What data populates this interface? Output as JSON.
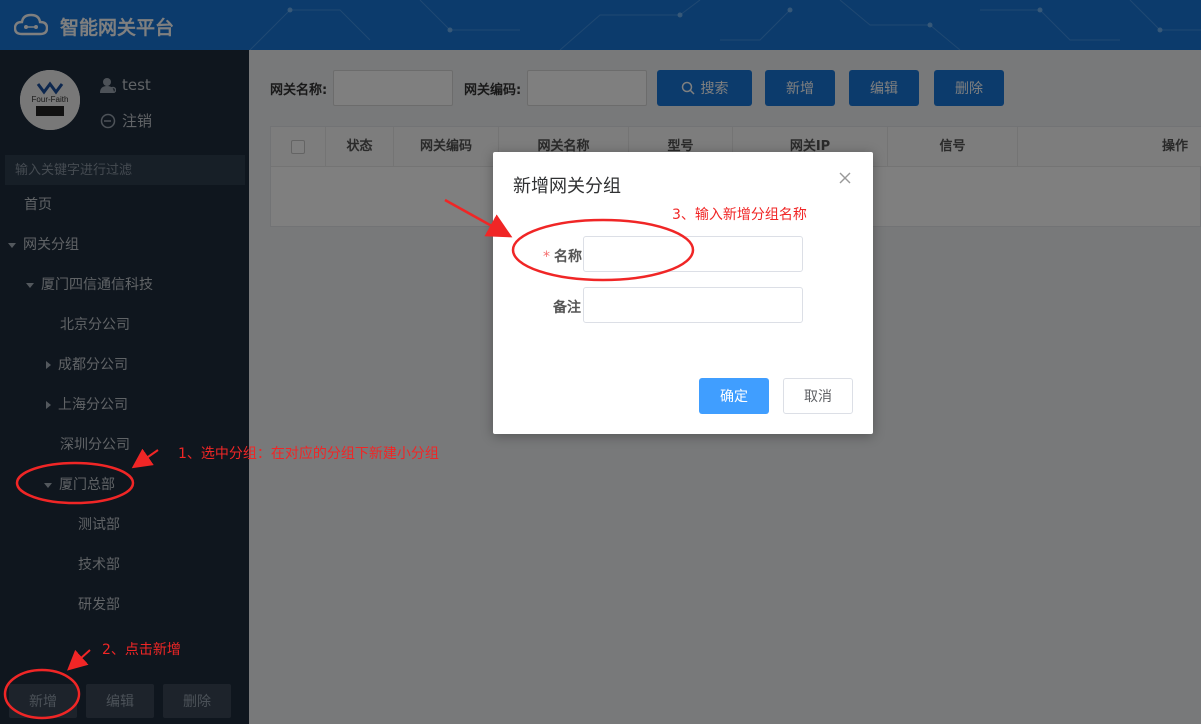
{
  "header": {
    "title": "智能网关平台"
  },
  "sidebar": {
    "username": "test",
    "logout": "注销",
    "filter_placeholder": "输入关键字进行过滤",
    "tree": {
      "home": "首页",
      "gateway_group": "网关分组",
      "company": "厦门四信通信科技",
      "beijing": "北京分公司",
      "chengdu": "成都分公司",
      "shanghai": "上海分公司",
      "shenzhen": "深圳分公司",
      "xiamen_hq": "厦门总部",
      "test_dept": "测试部",
      "tech_dept": "技术部",
      "rd_dept": "研发部"
    },
    "buttons": {
      "add": "新增",
      "edit": "编辑",
      "delete": "删除"
    },
    "logo_text": "Four-Faith"
  },
  "toolbar": {
    "name_label": "网关名称:",
    "code_label": "网关编码:",
    "search": "搜索",
    "add": "新增",
    "edit": "编辑",
    "delete": "删除"
  },
  "table": {
    "columns": [
      "状态",
      "网关编码",
      "网关名称",
      "型号",
      "网关IP",
      "信号",
      "操作"
    ]
  },
  "dialog": {
    "title": "新增网关分组",
    "name_label": "名称",
    "remark_label": "备注",
    "name_value": "",
    "remark_value": "",
    "ok": "确定",
    "cancel": "取消"
  },
  "annotations": {
    "step1": "1、选中分组：在对应的分组下新建小分组",
    "step2": "2、点击新增",
    "step3": "3、输入新增分组名称",
    "color": "#f02626"
  },
  "colors": {
    "header": "#1877d9",
    "sidebar": "#1f2d3d",
    "primary": "#409eff"
  }
}
